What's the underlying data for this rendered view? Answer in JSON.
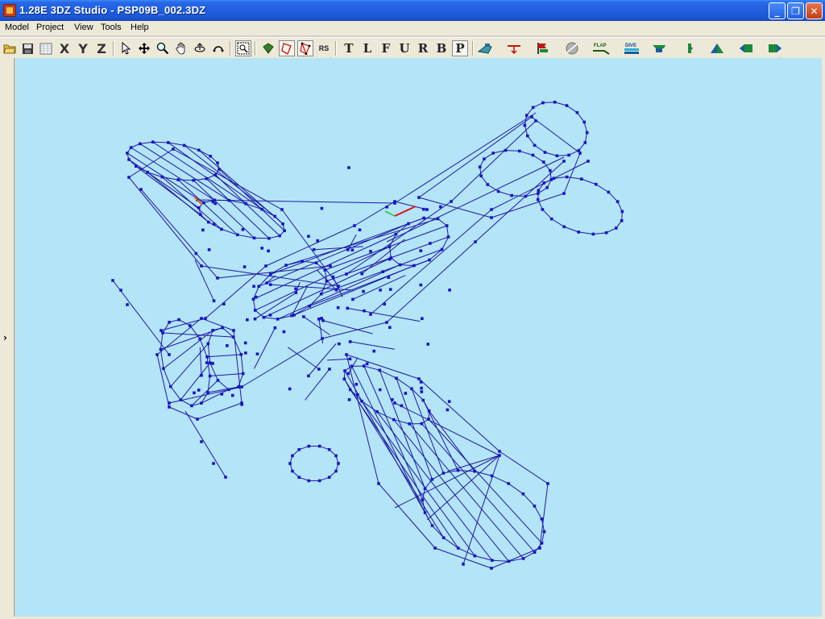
{
  "window": {
    "title": "1.28E 3DZ Studio - PSP09B_002.3DZ",
    "minimize_label": "_",
    "maximize_label": "❐",
    "close_label": "✕"
  },
  "menu": [
    "Model",
    "Project",
    "View",
    "Tools",
    "Help"
  ],
  "toolbar1": {
    "axis_x": "X",
    "axis_y": "Y",
    "axis_z": "Z",
    "rs_label": "RS",
    "view_top": "T",
    "view_left": "L",
    "view_front": "F",
    "view_up": "U",
    "view_right": "R",
    "view_back": "B",
    "view_perspective": "P",
    "flap_label": "FLAP",
    "dive_label": "DIVE"
  },
  "gutter": {
    "expand_arrow": "›"
  },
  "colors": {
    "viewport_bg": "#b4e4f8",
    "wire": "#1a1aa0",
    "vertex": "#1414c8",
    "titlebar": "#1f5fe0"
  }
}
